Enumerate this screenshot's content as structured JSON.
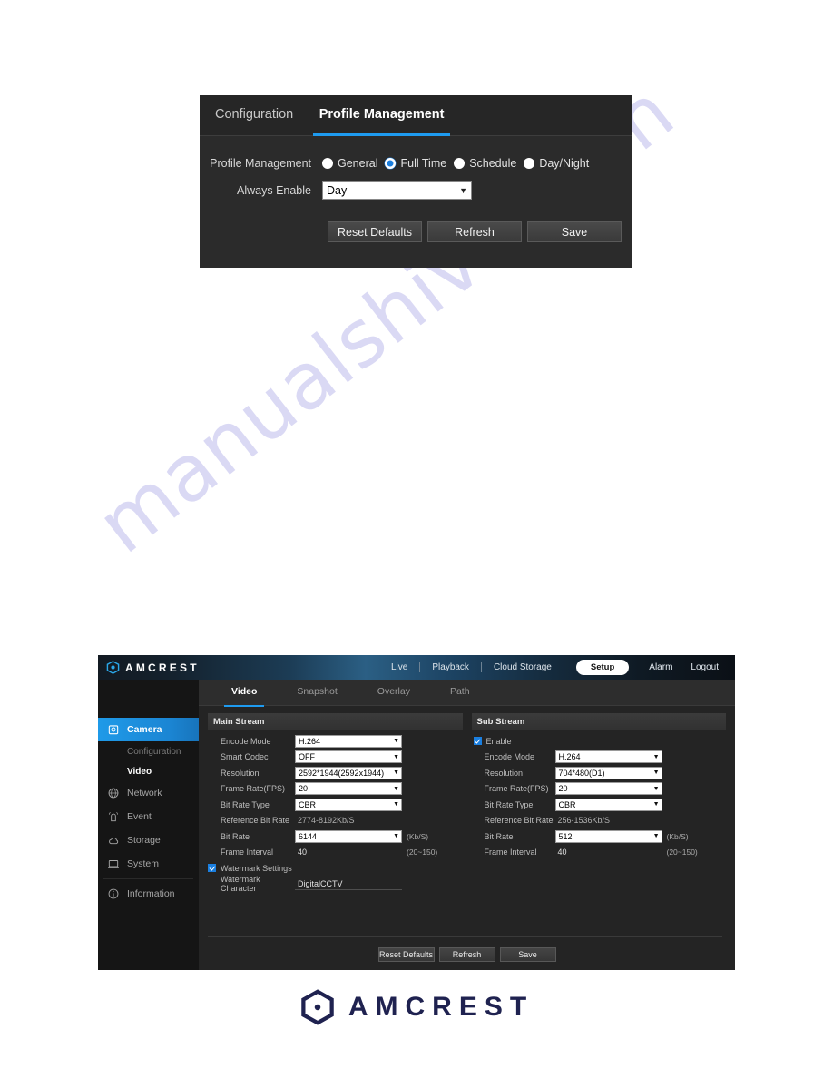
{
  "watermark": {
    "text": "manualshive.com"
  },
  "profile_panel": {
    "tabs": [
      {
        "label": "Configuration",
        "active": false
      },
      {
        "label": "Profile Management",
        "active": true
      }
    ],
    "rows": {
      "profile_management_label": "Profile Management",
      "always_enable_label": "Always Enable"
    },
    "radios": [
      {
        "label": "General",
        "selected": false
      },
      {
        "label": "Full Time",
        "selected": true
      },
      {
        "label": "Schedule",
        "selected": false
      },
      {
        "label": "Day/Night",
        "selected": false
      }
    ],
    "always_enable_value": "Day",
    "buttons": [
      "Reset Defaults",
      "Refresh",
      "Save"
    ]
  },
  "camera_ui": {
    "brand": "AMCREST",
    "nav": [
      "Live",
      "Playback",
      "Cloud Storage"
    ],
    "right_nav": {
      "setup": "Setup",
      "alarm": "Alarm",
      "logout": "Logout"
    },
    "sidebar": [
      {
        "label": "Camera",
        "icon": "camera-icon",
        "active": true
      },
      {
        "label": "Configuration",
        "icon": "",
        "sub": true,
        "current": false
      },
      {
        "label": "Video",
        "icon": "",
        "sub": true,
        "current": true
      },
      {
        "label": "Network",
        "icon": "globe-icon",
        "active": false
      },
      {
        "label": "Event",
        "icon": "alarm-icon",
        "active": false
      },
      {
        "label": "Storage",
        "icon": "cloud-icon",
        "active": false
      },
      {
        "label": "System",
        "icon": "monitor-icon",
        "active": false
      },
      {
        "label": "Information",
        "icon": "info-icon",
        "active": false
      }
    ],
    "tabs": [
      {
        "label": "Video",
        "active": true
      },
      {
        "label": "Snapshot",
        "active": false
      },
      {
        "label": "Overlay",
        "active": false
      },
      {
        "label": "Path",
        "active": false
      }
    ],
    "main_stream": {
      "title": "Main Stream",
      "fields": [
        {
          "label": "Encode Mode",
          "value": "H.264",
          "type": "select"
        },
        {
          "label": "Smart Codec",
          "value": "OFF",
          "type": "select"
        },
        {
          "label": "Resolution",
          "value": "2592*1944(2592x1944)",
          "type": "select"
        },
        {
          "label": "Frame Rate(FPS)",
          "value": "20",
          "type": "select"
        },
        {
          "label": "Bit Rate Type",
          "value": "CBR",
          "type": "select"
        },
        {
          "label": "Reference Bit Rate",
          "value": "2774-8192Kb/S",
          "type": "static"
        },
        {
          "label": "Bit Rate",
          "value": "6144",
          "type": "select",
          "unit": "(Kb/S)"
        },
        {
          "label": "Frame Interval",
          "value": "40",
          "type": "input",
          "unit": "(20~150)"
        }
      ],
      "watermark_settings_label": "Watermark Settings",
      "watermark_settings_checked": true,
      "watermark_character_label": "Watermark Character",
      "watermark_character_value": "DigitalCCTV"
    },
    "sub_stream": {
      "title": "Sub Stream",
      "enable_label": "Enable",
      "enable_checked": true,
      "fields": [
        {
          "label": "Encode Mode",
          "value": "H.264",
          "type": "select"
        },
        {
          "label": "Resolution",
          "value": "704*480(D1)",
          "type": "select"
        },
        {
          "label": "Frame Rate(FPS)",
          "value": "20",
          "type": "select"
        },
        {
          "label": "Bit Rate Type",
          "value": "CBR",
          "type": "select"
        },
        {
          "label": "Reference Bit Rate",
          "value": "256-1536Kb/S",
          "type": "static"
        },
        {
          "label": "Bit Rate",
          "value": "512",
          "type": "select",
          "unit": "(Kb/S)"
        },
        {
          "label": "Frame Interval",
          "value": "40",
          "type": "input",
          "unit": "(20~150)"
        }
      ]
    },
    "buttons": [
      "Reset Defaults",
      "Refresh",
      "Save"
    ]
  },
  "footer": {
    "brand": "AMCREST"
  },
  "colors": {
    "accent_blue": "#1e9bf0",
    "panel_bg": "#2b2b2b",
    "ui_bg": "#242424",
    "logo_navy": "#1f2250",
    "watermark": "#c5c3ee"
  }
}
